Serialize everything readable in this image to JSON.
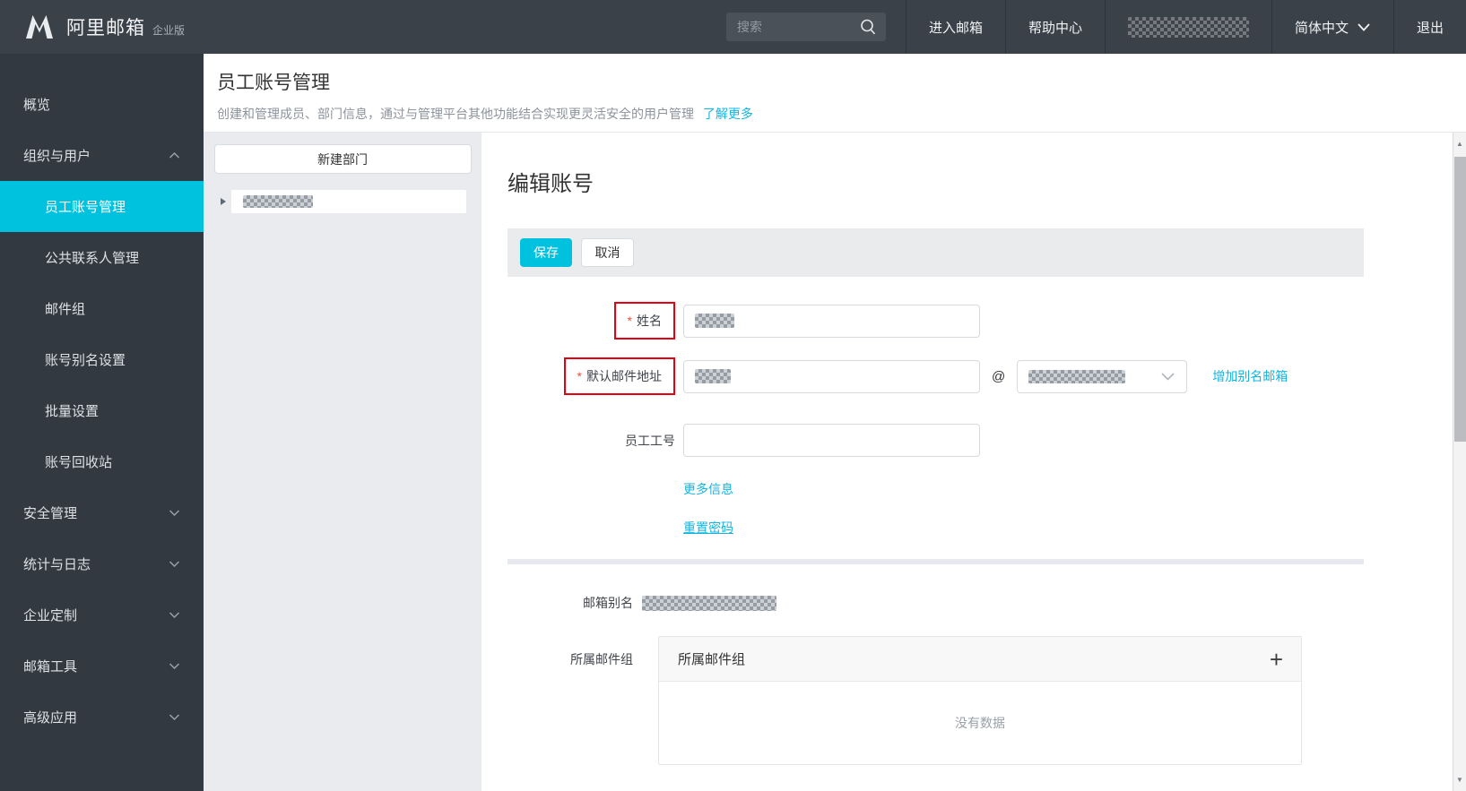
{
  "topbar": {
    "brand": {
      "name": "阿里邮箱",
      "edition": "企业版"
    },
    "search_placeholder": "搜索",
    "items": [
      {
        "label": "进入邮箱"
      },
      {
        "label": "帮助中心"
      },
      {
        "label": "简体中文"
      },
      {
        "label": "退出"
      }
    ]
  },
  "sidebar": {
    "items": [
      {
        "label": "概览"
      },
      {
        "label": "组织与用户"
      },
      {
        "label": "员工账号管理"
      },
      {
        "label": "公共联系人管理"
      },
      {
        "label": "邮件组"
      },
      {
        "label": "账号别名设置"
      },
      {
        "label": "批量设置"
      },
      {
        "label": "账号回收站"
      },
      {
        "label": "安全管理"
      },
      {
        "label": "统计与日志"
      },
      {
        "label": "企业定制"
      },
      {
        "label": "邮箱工具"
      },
      {
        "label": "高级应用"
      }
    ]
  },
  "page_header": {
    "title": "员工账号管理",
    "description": "创建和管理成员、部门信息，通过与管理平台其他功能结合实现更灵活安全的用户管理",
    "learn_more": "了解更多"
  },
  "tree_panel": {
    "new_dept_button": "新建部门"
  },
  "editor": {
    "title": "编辑账号",
    "save_button": "保存",
    "cancel_button": "取消",
    "required_mark": "*",
    "name_label": "姓名",
    "email_label": "默认邮件地址",
    "at_sign": "@",
    "add_alias_link": "增加别名邮箱",
    "staff_id_label": "员工工号",
    "more_info_link": "更多信息",
    "reset_password_link": "重置密码",
    "alias_label": "邮箱别名",
    "groups_label": "所属邮件组",
    "groups_panel_title": "所属邮件组",
    "no_data": "没有数据"
  },
  "icons": {
    "plus": "+",
    "scroll_up": "▲",
    "scroll_down": "▼"
  },
  "colors": {
    "accent_cyan": "#00c1de",
    "link_cyan": "#13b5e0",
    "annotation_red": "#e60012",
    "topbar_bg": "#3a4149",
    "sidebar_bg": "#323941"
  }
}
